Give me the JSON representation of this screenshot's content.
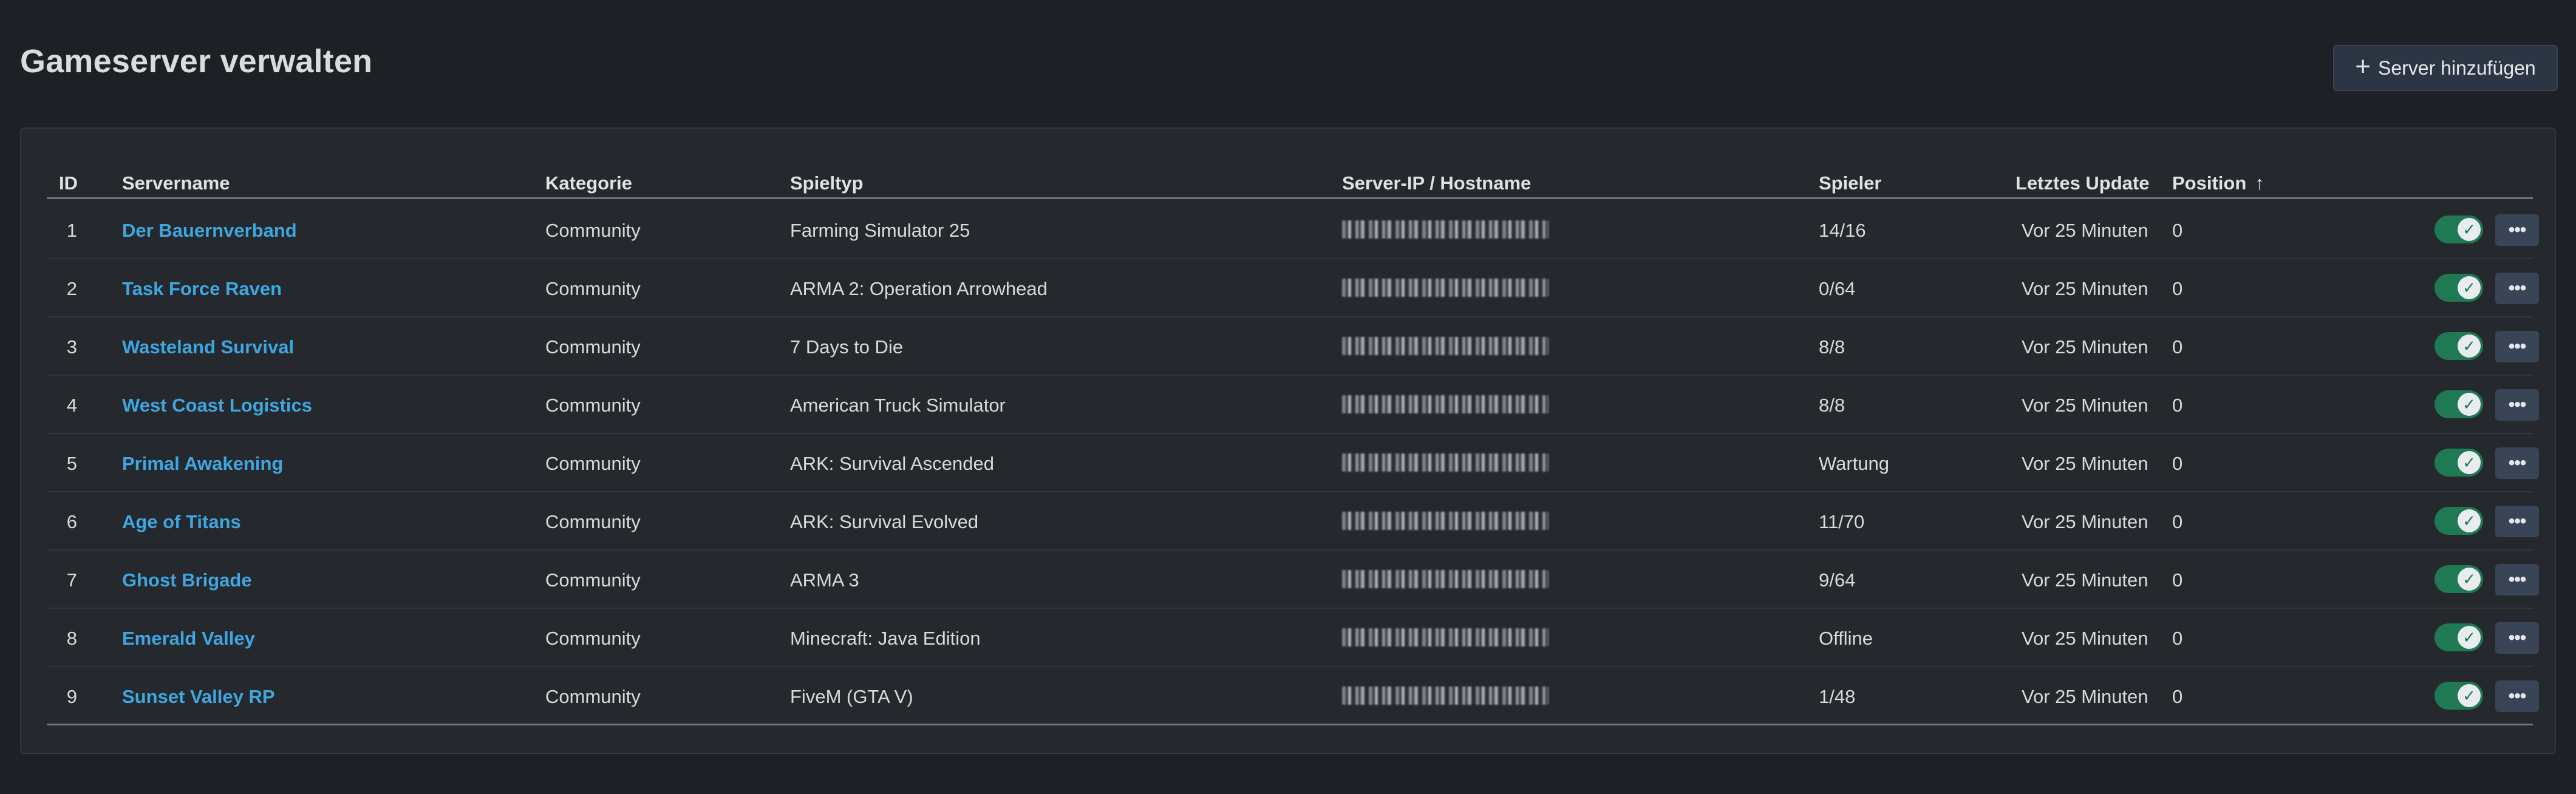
{
  "header": {
    "title": "Gameserver verwalten",
    "add_button_label": "Server hinzufügen",
    "add_icon": "+"
  },
  "table": {
    "columns": {
      "id": "ID",
      "name": "Servername",
      "category": "Kategorie",
      "game": "Spieltyp",
      "ip": "Server-IP / Hostname",
      "players": "Spieler",
      "updated": "Letztes Update",
      "position": "Position",
      "sort_icon": "↑"
    },
    "rows": [
      {
        "id": "1",
        "name": "Der Bauernverband",
        "category": "Community",
        "game": "Farming Simulator 25",
        "players": "14/16",
        "updated": "Vor 25 Minuten",
        "position": "0",
        "enabled": true
      },
      {
        "id": "2",
        "name": "Task Force Raven",
        "category": "Community",
        "game": "ARMA 2: Operation Arrowhead",
        "players": "0/64",
        "updated": "Vor 25 Minuten",
        "position": "0",
        "enabled": true
      },
      {
        "id": "3",
        "name": "Wasteland Survival",
        "category": "Community",
        "game": "7 Days to Die",
        "players": "8/8",
        "updated": "Vor 25 Minuten",
        "position": "0",
        "enabled": true
      },
      {
        "id": "4",
        "name": "West Coast Logistics",
        "category": "Community",
        "game": "American Truck Simulator",
        "players": "8/8",
        "updated": "Vor 25 Minuten",
        "position": "0",
        "enabled": true
      },
      {
        "id": "5",
        "name": "Primal Awakening",
        "category": "Community",
        "game": "ARK: Survival Ascended",
        "players": "Wartung",
        "updated": "Vor 25 Minuten",
        "position": "0",
        "enabled": true
      },
      {
        "id": "6",
        "name": "Age of Titans",
        "category": "Community",
        "game": "ARK: Survival Evolved",
        "players": "11/70",
        "updated": "Vor 25 Minuten",
        "position": "0",
        "enabled": true
      },
      {
        "id": "7",
        "name": "Ghost Brigade",
        "category": "Community",
        "game": "ARMA 3",
        "players": "9/64",
        "updated": "Vor 25 Minuten",
        "position": "0",
        "enabled": true
      },
      {
        "id": "8",
        "name": "Emerald Valley",
        "category": "Community",
        "game": "Minecraft: Java Edition",
        "players": "Offline",
        "updated": "Vor 25 Minuten",
        "position": "0",
        "enabled": true
      },
      {
        "id": "9",
        "name": "Sunset Valley RP",
        "category": "Community",
        "game": "FiveM (GTA V)",
        "players": "1/48",
        "updated": "Vor 25 Minuten",
        "position": "0",
        "enabled": true
      }
    ],
    "toggle_icon": "✓",
    "more_icon": "•••"
  },
  "colors": {
    "background": "#1d2024",
    "card": "#25282d",
    "link": "#3ea6e0",
    "toggle_on": "#1f7a53",
    "button": "#2c3543"
  }
}
